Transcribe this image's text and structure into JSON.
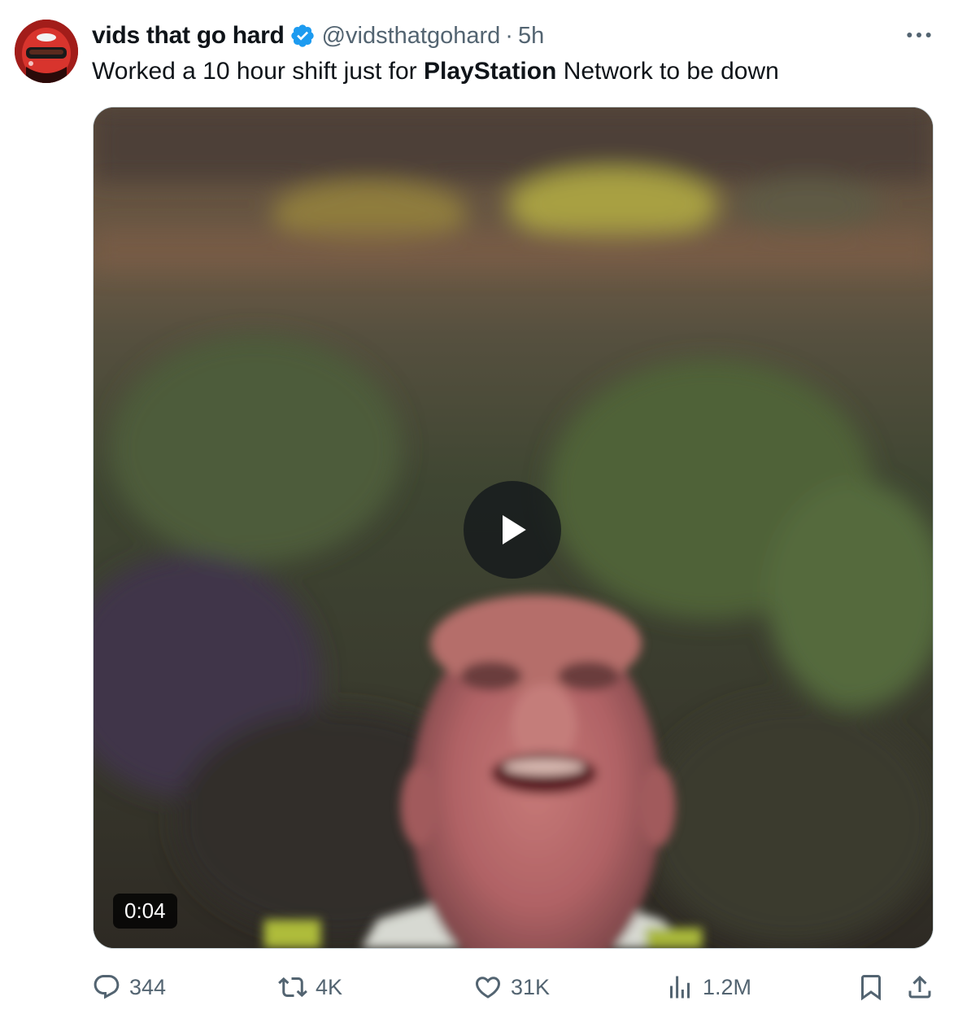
{
  "author": {
    "display_name": "vids that go hard",
    "handle": "@vidsthatgohard",
    "separator": "·",
    "time": "5h",
    "verified": true,
    "avatar_icon": "racing-helmet-avatar"
  },
  "tweet": {
    "text_before": "Worked a 10 hour shift just for ",
    "text_bold": "PlayStation",
    "text_after": " Network to be down"
  },
  "media": {
    "type": "video",
    "duration": "0:04",
    "play_icon": "play-icon"
  },
  "actions": {
    "replies": "344",
    "retweets": "4K",
    "likes": "31K",
    "views": "1.2M"
  },
  "colors": {
    "verified_blue": "#1d9bf0",
    "secondary_text": "#536471",
    "primary_text": "#0f1419"
  }
}
